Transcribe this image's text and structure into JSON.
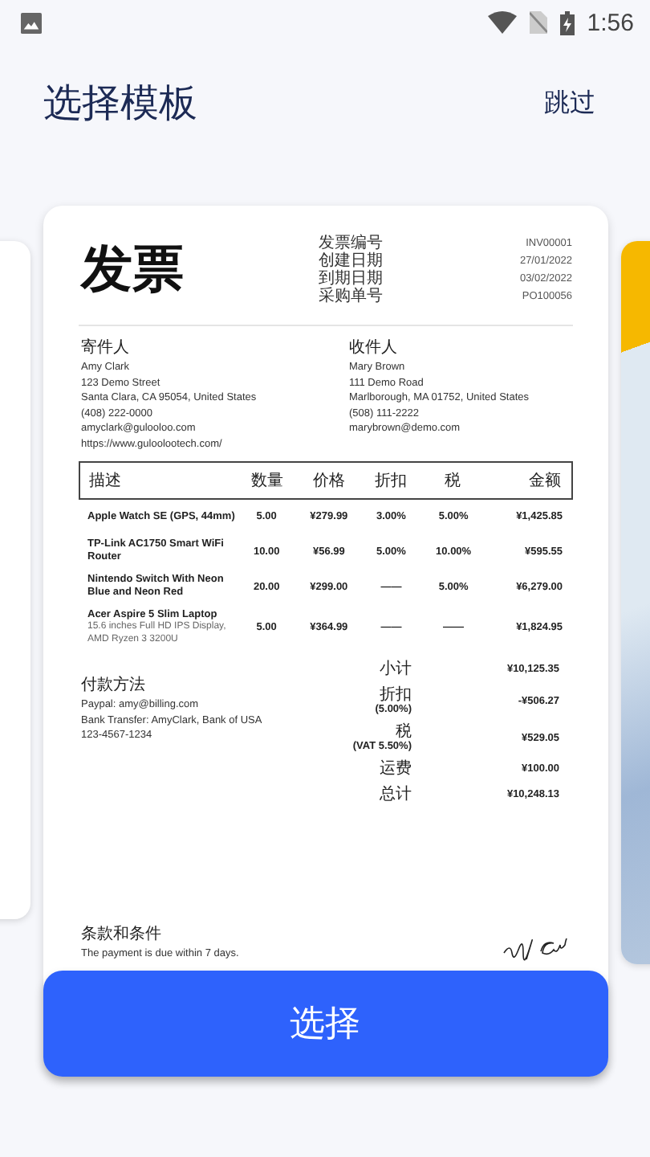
{
  "status_bar": {
    "time": "1:56"
  },
  "header": {
    "title": "选择模板",
    "skip": "跳过"
  },
  "invoice": {
    "title": "发票",
    "meta": [
      {
        "label": "发票编号",
        "value": "INV00001"
      },
      {
        "label": "创建日期",
        "value": "27/01/2022"
      },
      {
        "label": "到期日期",
        "value": "03/02/2022"
      },
      {
        "label": "采购单号",
        "value": "PO100056"
      }
    ],
    "parties": [
      {
        "heading": "寄件人",
        "lines": [
          "Amy Clark",
          "123 Demo Street",
          "Santa Clara, CA 95054, United States",
          "(408) 222-0000",
          "amyclark@gulooloo.com",
          "https://www.guloolootech.com/"
        ]
      },
      {
        "heading": "收件人",
        "lines": [
          "Mary Brown",
          "111 Demo Road",
          "Marlborough, MA 01752, United States",
          "(508) 111-2222",
          "marybrown@demo.com"
        ]
      }
    ],
    "table": {
      "columns": [
        "描述",
        "数量",
        "价格",
        "折扣",
        "税",
        "金额"
      ],
      "rows": [
        {
          "cells": [
            "Apple Watch SE (GPS, 44mm)",
            "5.00",
            "¥279.99",
            "3.00%",
            "5.00%",
            "¥1,425.85"
          ]
        },
        {
          "cells": [
            "TP-Link AC1750 Smart WiFi Router",
            "10.00",
            "¥56.99",
            "5.00%",
            "10.00%",
            "¥595.55"
          ]
        },
        {
          "cells": [
            "Nintendo Switch With Neon Blue and Neon Red",
            "20.00",
            "¥299.00",
            "——",
            "5.00%",
            "¥6,279.00"
          ]
        },
        {
          "cells": [
            "Acer Aspire 5 Slim Laptop",
            "5.00",
            "¥364.99",
            "——",
            "——",
            "¥1,824.95"
          ],
          "note": "15.6 inches Full HD IPS Display, AMD Ryzen 3 3200U"
        }
      ]
    },
    "payment": {
      "heading": "付款方法",
      "lines": [
        "Paypal: amy@billing.com",
        "Bank Transfer: AmyClark, Bank of USA",
        "123-4567-1234"
      ]
    },
    "totals": [
      {
        "label": "小计",
        "value": "¥10,125.35"
      },
      {
        "label": "折扣",
        "sublabel": "(5.00%)",
        "value": "-¥506.27"
      },
      {
        "label": "税",
        "sublabel": "(VAT 5.50%)",
        "value": "¥529.05"
      },
      {
        "label": "运费",
        "value": "¥100.00"
      },
      {
        "label": "总计",
        "value": "¥10,248.13"
      }
    ],
    "terms": {
      "heading": "条款和条件",
      "text": "The payment is due within 7 days."
    }
  },
  "select_button": "选择"
}
